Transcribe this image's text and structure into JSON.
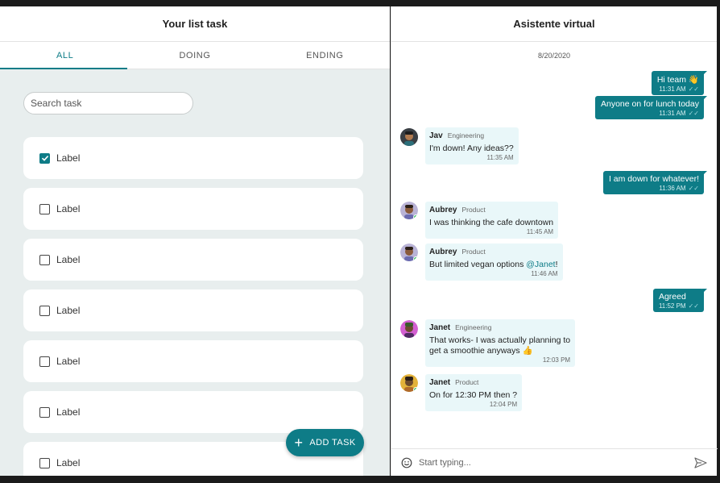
{
  "tasks_panel": {
    "title": "Your list task",
    "tabs": [
      {
        "label": "ALL",
        "active": true
      },
      {
        "label": "DOING",
        "active": false
      },
      {
        "label": "ENDING",
        "active": false
      }
    ],
    "search_placeholder": "Search task",
    "tasks": [
      {
        "label": "Label",
        "checked": true
      },
      {
        "label": "Label",
        "checked": false
      },
      {
        "label": "Label",
        "checked": false
      },
      {
        "label": "Label",
        "checked": false
      },
      {
        "label": "Label",
        "checked": false
      },
      {
        "label": "Label",
        "checked": false
      },
      {
        "label": "Label",
        "checked": false
      }
    ],
    "add_task_label": "ADD TASK"
  },
  "chat_panel": {
    "title": "Asistente virtual",
    "date": "8/20/2020",
    "messages": [
      {
        "direction": "out",
        "text": "Hi team 👋",
        "time": "11:31 AM"
      },
      {
        "direction": "out",
        "text": "Anyone on for lunch today",
        "time": "11:31 AM"
      },
      {
        "direction": "in",
        "name": "Jav",
        "role": "Engineering",
        "text": "I'm down! Any ideas??",
        "time": "11:35 AM"
      },
      {
        "direction": "out",
        "text": "I am down for whatever!",
        "time": "11:36 AM"
      },
      {
        "direction": "in",
        "name": "Aubrey",
        "role": "Product",
        "text": "I was thinking the cafe downtown",
        "time": "11:45 AM"
      },
      {
        "direction": "in",
        "name": "Aubrey",
        "role": "Product",
        "text": "But limited vegan options ",
        "mention": "@Janet",
        "text_after": "!",
        "time": "11:46 AM"
      },
      {
        "direction": "out",
        "text": "Agreed",
        "time": "11:52 PM"
      },
      {
        "direction": "in",
        "name": "Janet",
        "role": "Engineering",
        "text": "That works- I was actually planning to",
        "text2": "get a smoothie anyways 👍",
        "time": "12:03 PM"
      },
      {
        "direction": "in",
        "name": "Janet",
        "role": "Product",
        "text": "On for 12:30 PM then ?",
        "time": "12:04 PM"
      }
    ],
    "composer_placeholder": "Start typing..."
  },
  "colors": {
    "accent": "#0e7c87",
    "panel_bg": "#e8eeee",
    "incoming_bubble": "#e9f7f9"
  }
}
